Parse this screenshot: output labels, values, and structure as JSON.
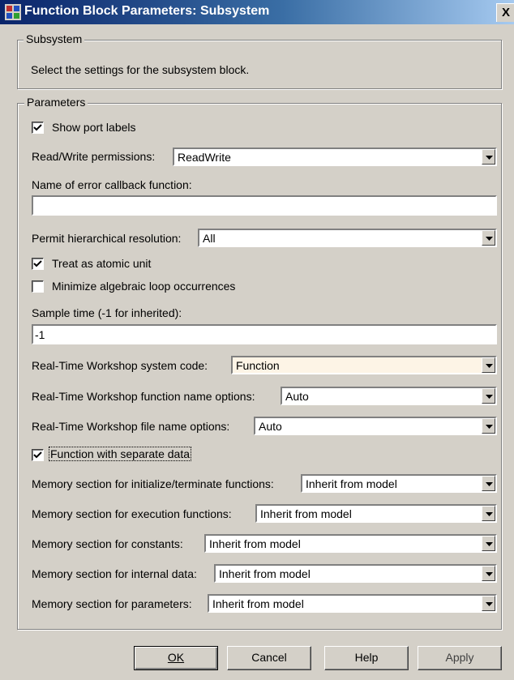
{
  "window": {
    "title": "Function Block Parameters: Subsystem",
    "close_label": "X"
  },
  "subsystem_group": {
    "legend": "Subsystem",
    "description": "Select the settings for the subsystem block."
  },
  "parameters_group": {
    "legend": "Parameters",
    "show_port_labels": {
      "label": "Show port labels",
      "checked": true
    },
    "read_write": {
      "label": "Read/Write permissions:",
      "value": "ReadWrite"
    },
    "error_callback": {
      "label": "Name of error callback function:",
      "value": ""
    },
    "hierarchical_resolution": {
      "label": "Permit hierarchical resolution:",
      "value": "All"
    },
    "treat_atomic": {
      "label": "Treat as atomic unit",
      "checked": true
    },
    "minimize_loop": {
      "label": "Minimize algebraic loop occurrences",
      "checked": false
    },
    "sample_time": {
      "label": "Sample time (-1 for inherited):",
      "value": "-1"
    },
    "rtw_system_code": {
      "label": "Real-Time Workshop system code:",
      "value": "Function"
    },
    "rtw_function_name": {
      "label": "Real-Time Workshop function name options:",
      "value": "Auto"
    },
    "rtw_file_name": {
      "label": "Real-Time Workshop file name options:",
      "value": "Auto"
    },
    "separate_data": {
      "label": "Function with separate data",
      "checked": true
    },
    "mem_init_term": {
      "label": "Memory section for initialize/terminate functions:",
      "value": "Inherit from model"
    },
    "mem_execution": {
      "label": "Memory section for execution functions:",
      "value": "Inherit from model"
    },
    "mem_constants": {
      "label": "Memory section for constants:",
      "value": "Inherit from model"
    },
    "mem_internal": {
      "label": "Memory section for internal data:",
      "value": "Inherit from model"
    },
    "mem_parameters": {
      "label": "Memory section for parameters:",
      "value": "Inherit from model"
    }
  },
  "buttons": {
    "ok": "OK",
    "cancel": "Cancel",
    "help": "Help",
    "apply": "Apply"
  },
  "colors": {
    "titlebar_start": "#0a246a",
    "titlebar_end": "#a6caf0",
    "dialog_face": "#d4d0c8",
    "highlight_field": "#fdf4e6"
  }
}
